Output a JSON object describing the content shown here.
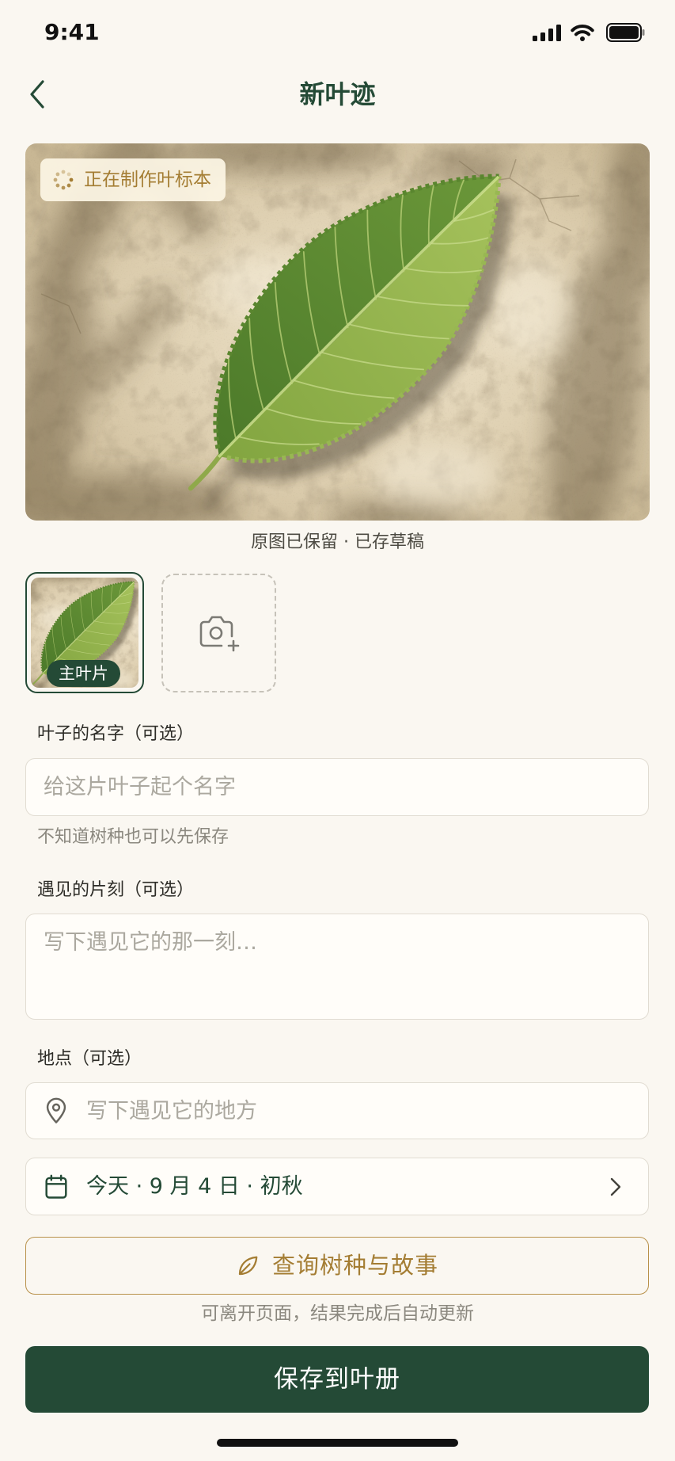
{
  "status_bar": {
    "time": "9:41",
    "icons": [
      "cellular-signal-icon",
      "wifi-icon",
      "battery-icon"
    ]
  },
  "header": {
    "title": "新叶迹",
    "back_icon": "chevron-left-icon"
  },
  "hero": {
    "status_icon": "loading-spinner-icon",
    "status_badge": "正在制作叶标本",
    "caption": "原图已保留 · 已存草稿"
  },
  "photos": {
    "items": [
      {
        "tag": "主叶片",
        "selected": true
      }
    ],
    "add_icon": "camera-plus-icon"
  },
  "form": {
    "name": {
      "label": "叶子的名字（可选）",
      "placeholder": "给这片叶子起个名字",
      "value": "",
      "hint": "不知道树种也可以先保存"
    },
    "moment": {
      "label": "遇见的片刻（可选）",
      "placeholder": "写下遇见它的那一刻…",
      "value": ""
    },
    "location": {
      "label": "地点（可选）",
      "icon": "map-pin-icon",
      "placeholder": "写下遇见它的地方",
      "value": ""
    },
    "date": {
      "icon": "calendar-icon",
      "text": "今天 · 9 月 4 日 · 初秋",
      "chevron_icon": "chevron-right-icon"
    }
  },
  "actions": {
    "identify": {
      "icon": "leaf-icon",
      "label": "查询树种与故事",
      "hint": "可离开页面，结果完成后自动更新"
    },
    "save": {
      "label": "保存到叶册"
    }
  },
  "colors": {
    "background": "#faf7f1",
    "primary_green": "#244a36",
    "accent_gold": "#a47d33",
    "accent_gold_border": "#b8914a",
    "text_primary": "#2e2d28",
    "text_muted": "#8b887f",
    "placeholder": "#aba89f",
    "border": "#e1dcd2"
  }
}
